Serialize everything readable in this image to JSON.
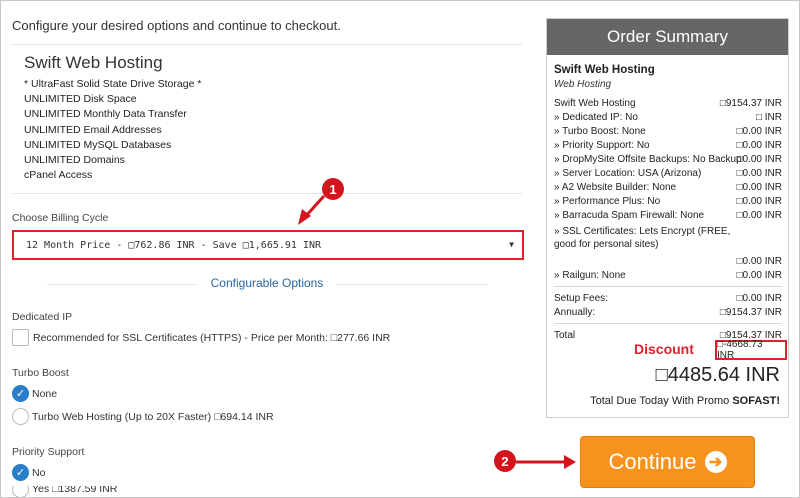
{
  "intro": "Configure your desired options and continue to checkout.",
  "product": {
    "name": "Swift Web Hosting",
    "features": [
      "* UltraFast Solid State Drive Storage *",
      "UNLIMITED Disk Space",
      "UNLIMITED Monthly Data Transfer",
      "UNLIMITED Email Addresses",
      "UNLIMITED MySQL Databases",
      "UNLIMITED Domains",
      "cPanel Access"
    ]
  },
  "billing": {
    "label": "Choose Billing Cycle",
    "selected": "12 Month Price - □762.86 INR - Save □1,665.91 INR"
  },
  "config": {
    "title": "Configurable Options",
    "dedicated_ip": {
      "label": "Dedicated IP",
      "option": "Recommended for SSL Certificates (HTTPS) - Price per Month: □277.66 INR"
    },
    "turbo_boost": {
      "label": "Turbo Boost",
      "option_none": "None",
      "option_turbo": "Turbo Web Hosting (Up to 20X Faster) □694.14 INR"
    },
    "priority_support": {
      "label": "Priority Support",
      "option_no": "No",
      "option_yes": "Yes □1387.59 INR"
    }
  },
  "summary": {
    "title": "Order Summary",
    "product": "Swift Web Hosting",
    "group": "Web Hosting",
    "lines": [
      {
        "label": "Swift Web Hosting",
        "value": "□9154.37 INR"
      },
      {
        "label": "» Dedicated IP: No",
        "value": "□ INR"
      },
      {
        "label": "» Turbo Boost: None",
        "value": "□0.00 INR"
      },
      {
        "label": "» Priority Support: No",
        "value": "□0.00 INR"
      },
      {
        "label": "» DropMySite Offsite Backups: No Backup",
        "value": "□0.00 INR"
      },
      {
        "label": "» Server Location: USA (Arizona)",
        "value": "□0.00 INR"
      },
      {
        "label": "» A2 Website Builder: None",
        "value": "□0.00 INR"
      },
      {
        "label": "» Performance Plus: No",
        "value": "□0.00 INR"
      },
      {
        "label": "» Barracuda Spam Firewall: None",
        "value": "□0.00 INR"
      }
    ],
    "ssl_label": "» SSL Certificates: Lets Encrypt (FREE, good for personal sites)",
    "ssl_value": "□0.00 INR",
    "railgun_label": "» Railgun: None",
    "railgun_value": "□0.00 INR",
    "setup_label": "Setup Fees:",
    "setup_value": "□0.00 INR",
    "annually_label": "Annually:",
    "annually_value": "□9154.37 INR",
    "total_label": "Total",
    "total_value": "□9154.37 INR",
    "discount_tag": "Discount",
    "discount_value": "□-4668.73 INR",
    "grand_total": "□4485.64 INR",
    "due_prefix": "Total Due Today With Promo ",
    "promo_code": "SOFAST!"
  },
  "continue_label": "Continue",
  "markers": {
    "one": "1",
    "two": "2"
  },
  "colors": {
    "highlight_red": "#e0202a",
    "continue_orange": "#f7931d",
    "link_blue": "#26669e",
    "header_gray": "#666666"
  }
}
